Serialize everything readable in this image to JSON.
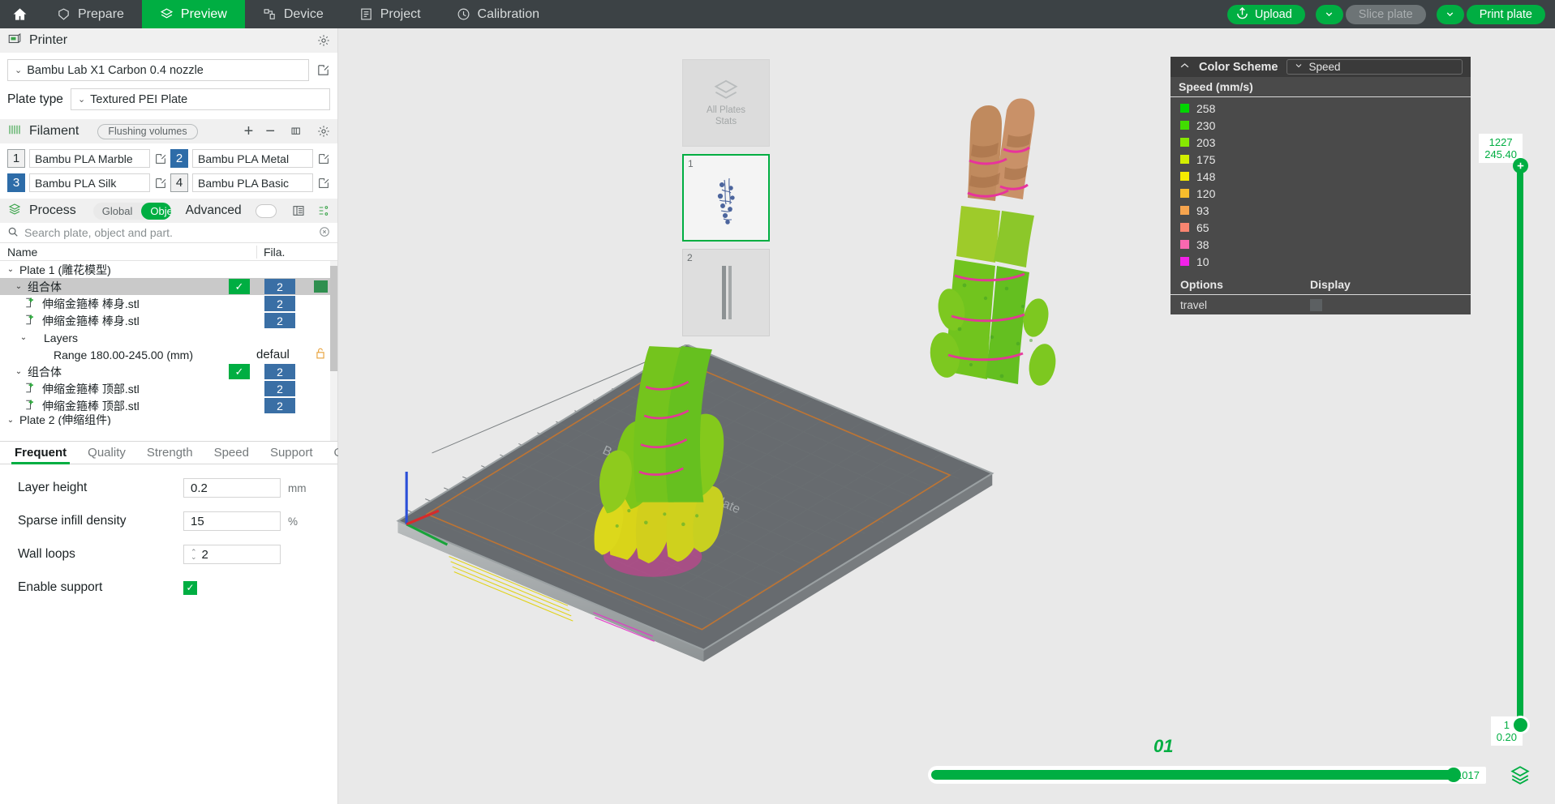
{
  "topbar": {
    "home_icon": "home-icon",
    "tabs": [
      {
        "label": "Prepare",
        "icon": "prepare-icon",
        "active": false
      },
      {
        "label": "Preview",
        "icon": "layers-icon",
        "active": true
      },
      {
        "label": "Device",
        "icon": "device-icon",
        "active": false
      },
      {
        "label": "Project",
        "icon": "project-icon",
        "active": false
      },
      {
        "label": "Calibration",
        "icon": "calibration-icon",
        "active": false
      }
    ],
    "upload_label": "Upload",
    "slice_plate_label": "Slice plate",
    "print_plate_label": "Print plate",
    "accent": "#00ae42",
    "bar_bg": "#3c4245"
  },
  "printer": {
    "section_title": "Printer",
    "model": "Bambu Lab X1 Carbon 0.4 nozzle",
    "plate_type_label": "Plate type",
    "plate_type_value": "Textured PEI Plate"
  },
  "filament": {
    "section_title": "Filament",
    "flushing_volumes_label": "Flushing volumes",
    "slots": [
      {
        "index": "1",
        "name": "Bambu PLA Marble",
        "selected": false
      },
      {
        "index": "2",
        "name": "Bambu PLA Metal",
        "selected": true
      },
      {
        "index": "3",
        "name": "Bambu PLA Silk",
        "selected": true
      },
      {
        "index": "4",
        "name": "Bambu PLA Basic",
        "selected": false
      }
    ]
  },
  "process": {
    "section_title": "Process",
    "toggle_global": "Global",
    "toggle_objects": "Objects",
    "toggle_active": "Objects",
    "advanced_label": "Advanced",
    "search_placeholder": "Search plate, object and part."
  },
  "object_tree": {
    "col_name": "Name",
    "col_fila": "Fila.",
    "rows": [
      {
        "label": "Plate 1 (雕花模型)",
        "indent": 0,
        "chevron": "v",
        "check": "",
        "fila": "",
        "selected": false,
        "type": "plate"
      },
      {
        "label": "组合体",
        "indent": 1,
        "chevron": "v",
        "check": "✓",
        "fila": "2",
        "selected": true,
        "type": "object"
      },
      {
        "label": "伸缩金箍棒 棒身.stl",
        "indent": 2,
        "chevron": "",
        "check": "",
        "fila": "2",
        "selected": false,
        "type": "part"
      },
      {
        "label": "伸缩金箍棒 棒身.stl",
        "indent": 2,
        "chevron": "",
        "check": "",
        "fila": "2",
        "selected": false,
        "type": "part"
      },
      {
        "label": "Layers",
        "indent": 2,
        "chevron": "v",
        "check": "",
        "fila": "",
        "selected": false,
        "type": "group"
      },
      {
        "label": "Range 180.00-245.00 (mm)",
        "indent": 3,
        "chevron": "",
        "check": "",
        "fila": "defaul",
        "selected": false,
        "type": "range"
      },
      {
        "label": "组合体",
        "indent": 1,
        "chevron": "v",
        "check": "✓",
        "fila": "2",
        "selected": false,
        "type": "object"
      },
      {
        "label": "伸缩金箍棒 顶部.stl",
        "indent": 2,
        "chevron": "",
        "check": "",
        "fila": "2",
        "selected": false,
        "type": "part"
      },
      {
        "label": "伸缩金箍棒 顶部.stl",
        "indent": 2,
        "chevron": "",
        "check": "",
        "fila": "2",
        "selected": false,
        "type": "part"
      },
      {
        "label": "Plate 2 (伸缩组件)",
        "indent": 0,
        "chevron": "v",
        "check": "",
        "fila": "",
        "selected": false,
        "type": "plate"
      }
    ]
  },
  "settings": {
    "tabs": [
      {
        "label": "Frequent",
        "active": true
      },
      {
        "label": "Quality",
        "active": false
      },
      {
        "label": "Strength",
        "active": false
      },
      {
        "label": "Speed",
        "active": false
      },
      {
        "label": "Support",
        "active": false
      },
      {
        "label": "Others",
        "active": false
      }
    ],
    "fields": [
      {
        "label": "Layer height",
        "value": "0.2",
        "unit": "mm",
        "kind": "text"
      },
      {
        "label": "Sparse infill density",
        "value": "15",
        "unit": "%",
        "kind": "text"
      },
      {
        "label": "Wall loops",
        "value": "2",
        "unit": "",
        "kind": "spin"
      },
      {
        "label": "Enable support",
        "value": "✓",
        "unit": "",
        "kind": "check"
      }
    ]
  },
  "plates": {
    "all_plates_line1": "All Plates",
    "all_plates_line2": "Stats",
    "items": [
      {
        "num": "1",
        "selected": true
      },
      {
        "num": "2",
        "selected": false
      }
    ]
  },
  "legend": {
    "collapse_icon": "chevron-up-icon",
    "title": "Color Scheme",
    "select_value": "Speed",
    "scale_title": "Speed (mm/s)",
    "items": [
      {
        "value": "258",
        "color": "#00d500"
      },
      {
        "value": "230",
        "color": "#41dd00"
      },
      {
        "value": "203",
        "color": "#87e800"
      },
      {
        "value": "175",
        "color": "#d2ee00"
      },
      {
        "value": "148",
        "color": "#f6eb00"
      },
      {
        "value": "120",
        "color": "#f8bd2c"
      },
      {
        "value": "93",
        "color": "#f7a košer"
      },
      {
        "value": "65",
        "color": "#fa8570"
      },
      {
        "value": "38",
        "color": "#f968b0"
      },
      {
        "value": "10",
        "color": "#f321e8"
      }
    ],
    "options_header": "Options",
    "display_header": "Display",
    "option_rows": [
      {
        "name": "travel",
        "display_color": "#5c6062"
      }
    ]
  },
  "vertical_slider": {
    "top_layer": "1227",
    "top_height": "245.40",
    "bottom_layer": "1",
    "bottom_height": "0.20",
    "plus_icon": "plus-icon"
  },
  "horizontal_slider": {
    "value": "1017"
  },
  "viewport": {
    "plate_label": "01",
    "bed_text": "Bambu Textured PEI Plate",
    "layers_icon": "layers-stack-icon"
  }
}
